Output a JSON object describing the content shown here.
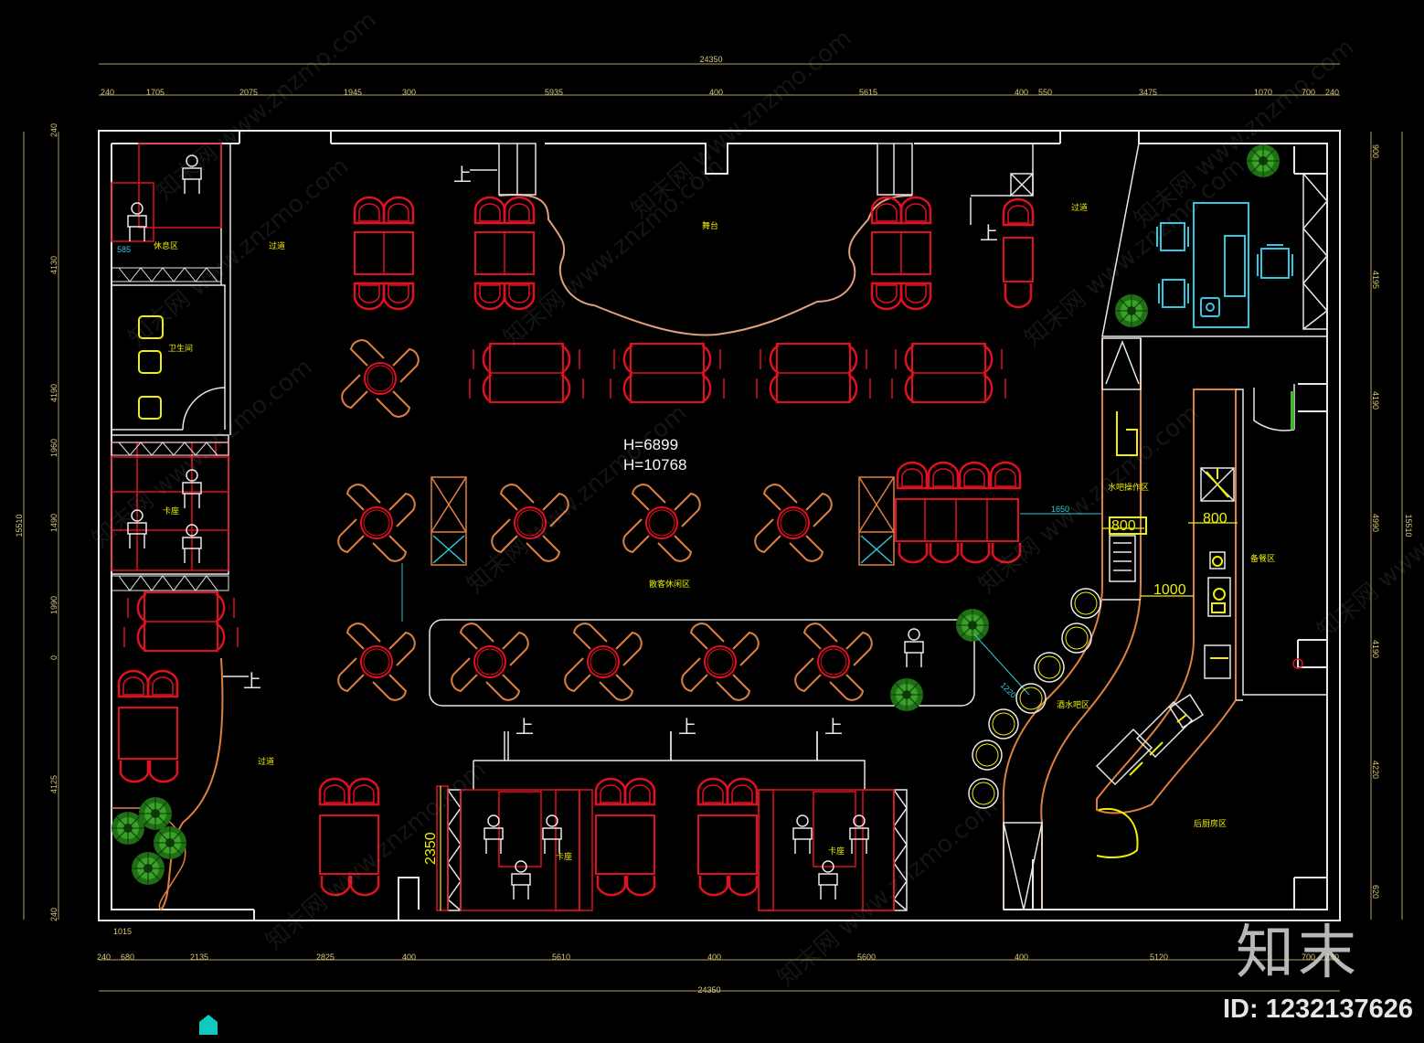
{
  "dims_top": [
    "240",
    "1705",
    "2075",
    "1945",
    "300",
    "5935",
    "400",
    "5615",
    "400",
    "550",
    "3475",
    "1070",
    "700",
    "240"
  ],
  "dims_bottom": [
    "240",
    "680",
    "2135",
    "2825",
    "400",
    "5610",
    "400",
    "5600",
    "400",
    "5120",
    "700",
    "240"
  ],
  "dims_left": [
    "240",
    "4130",
    "4190",
    "1960",
    "1490",
    "1990",
    "0",
    "4125",
    "240"
  ],
  "dims_right": [
    "900",
    "4195",
    "4190",
    "4990",
    "4190",
    "4220",
    "620"
  ],
  "total_width": "24350",
  "total_height": "15510",
  "dim_small_left": "1015",
  "heights": {
    "line1": "H=6899",
    "line2": "H=10768"
  },
  "dims_bold": {
    "d2350": "2350",
    "d800a": "800",
    "d800b": "800",
    "d1000": "1000"
  },
  "cyan_dims": {
    "c585": "585",
    "c1650": "1650",
    "c1220": "1220"
  },
  "labels": {
    "up": "上",
    "wait": "休息区",
    "corridor1": "过道",
    "stage": "舞台",
    "corridor2": "过道",
    "booth1": "卡座",
    "booth2": "卡座",
    "booth3": "卡座",
    "dining": "散客休闲区",
    "bar": "酒水吧区",
    "bar_prep": "水吧操作区",
    "kitchen_prep": "备餐区",
    "kitchen": "后厨房区",
    "corridor3": "过道",
    "toilet": "卫生间"
  },
  "watermark": {
    "brand": "知末",
    "id": "ID: 1232137626",
    "site": "知末网 www.znzmo.com"
  },
  "colors": {
    "wall": "#e8e8e8",
    "furniture": "#e01020",
    "orange": "#e0803a",
    "yellow": "#f0f000",
    "cyan": "#30c8e0",
    "green": "#2a8a20",
    "dim": "#b0a060"
  }
}
